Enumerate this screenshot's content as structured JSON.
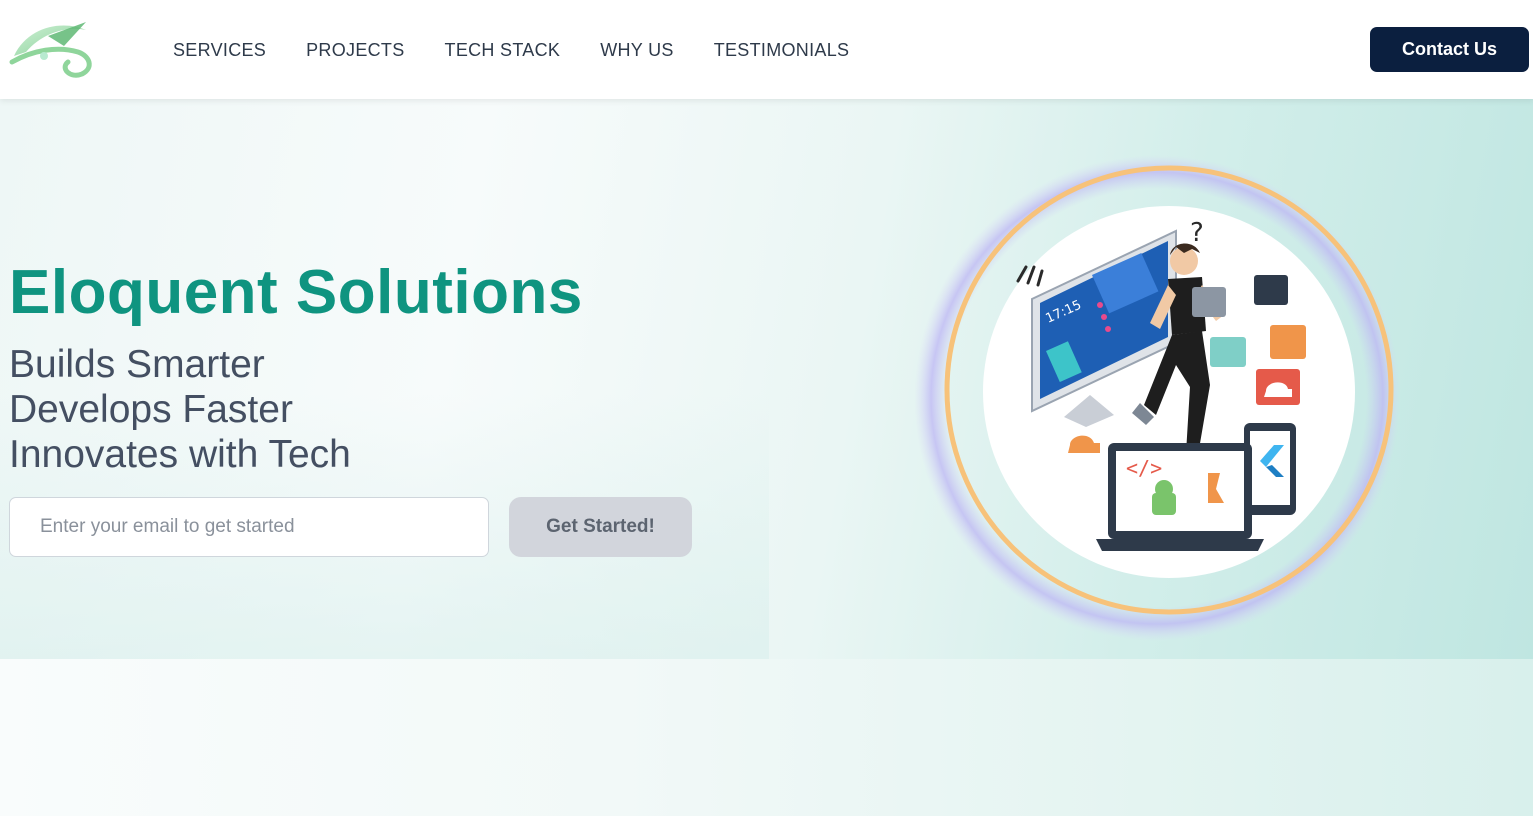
{
  "header": {
    "logo_icon": "swirl-logo-icon",
    "nav": [
      {
        "label": "SERVICES"
      },
      {
        "label": "PROJECTS"
      },
      {
        "label": "TECH STACK"
      },
      {
        "label": "WHY US"
      },
      {
        "label": "TESTIMONIALS"
      }
    ],
    "contact_label": "Contact Us"
  },
  "hero": {
    "title": "Eloquent Solutions",
    "taglines": [
      "Builds Smarter",
      "Develops Faster",
      "Innovates with Tech"
    ],
    "email_placeholder": "Enter your email to get started",
    "email_value": "",
    "cta_label": "Get Started!",
    "illustration_icon": "developer-illustration-icon",
    "illustration_time": "17:15",
    "colors": {
      "title": "#0f9480",
      "contact_bg": "#0b1f3f",
      "ring": "#f7c27a"
    }
  }
}
